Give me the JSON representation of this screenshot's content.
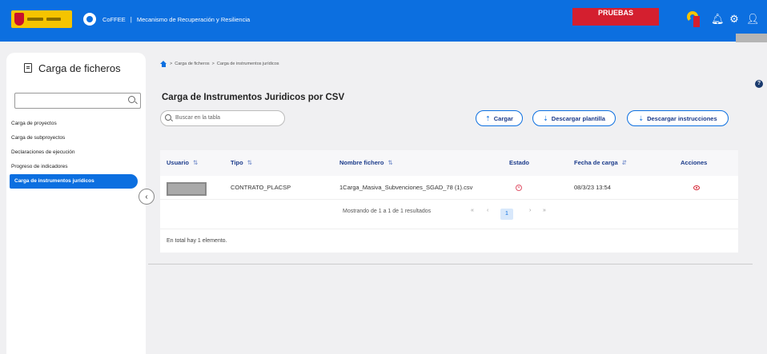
{
  "header": {
    "app_name": "CoFFEE",
    "separator": "|",
    "app_subtitle": "Mecanismo de Recuperación y Resiliencia",
    "environment_badge": "PRUEBAS",
    "icons": [
      "bell-icon",
      "gear-icon",
      "user-icon"
    ],
    "brand_color": "#0c6fe0",
    "badge_color": "#d41f2f"
  },
  "sidebar": {
    "title": "Carga de ficheros",
    "search_placeholder": "",
    "items": [
      {
        "label": "Carga de proyectos",
        "active": false
      },
      {
        "label": "Carga de subproyectos",
        "active": false
      },
      {
        "label": "Declaraciones de ejecución",
        "active": false
      },
      {
        "label": "Progreso de indicadores",
        "active": false
      },
      {
        "label": "Carga de instrumentos jurídicos",
        "active": true
      }
    ],
    "collapse_icon": "chevron-left-icon"
  },
  "breadcrumb": {
    "items": [
      "Carga de ficheros",
      "Carga de instrumentos jurídicos"
    ],
    "separator": ">"
  },
  "main": {
    "title": "Carga de Instrumentos Juridicos por CSV",
    "search_placeholder": "Buscar en la tabla",
    "buttons": {
      "cargar": "Cargar",
      "plantilla": "Descargar plantilla",
      "instrucciones": "Descargar instrucciones"
    }
  },
  "table": {
    "columns": [
      "Usuario",
      "Tipo",
      "Nombre fichero",
      "Estado",
      "Fecha de carga",
      "Acciones"
    ],
    "rows": [
      {
        "usuario": "",
        "tipo": "CONTRATO_PLACSP",
        "nombre_fichero": "1Carga_Masiva_Subvenciones_SGAD_78 (1).csv",
        "estado": "error",
        "fecha": "08/3/23 13:54",
        "accion": "eye-icon"
      }
    ],
    "pagination": {
      "text": "Mostrando de 1 a 1 de 1 resultados",
      "first": "«",
      "prev": "‹",
      "current": "1",
      "next": "›",
      "last": "»"
    },
    "total": "En total hay 1 elemento."
  }
}
